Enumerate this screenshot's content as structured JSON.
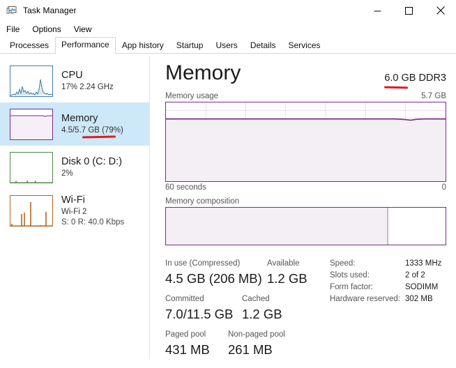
{
  "window": {
    "title": "Task Manager",
    "icon": "task-manager-icon",
    "controls": {
      "minimize": "–",
      "maximize": "☐",
      "close": "✕"
    }
  },
  "menu": {
    "items": [
      "File",
      "Options",
      "View"
    ]
  },
  "tabs": {
    "items": [
      "Processes",
      "Performance",
      "App history",
      "Startup",
      "Users",
      "Details",
      "Services"
    ],
    "active": "Performance"
  },
  "sidebar": {
    "items": [
      {
        "name": "CPU",
        "line1": "17%  2.24 GHz",
        "line2": "",
        "selected": false,
        "color": "#3d7fa6"
      },
      {
        "name": "Memory",
        "line1": "4.5/5.7 GB (79%)",
        "line2": "",
        "selected": true,
        "color": "#7a2b86"
      },
      {
        "name": "Disk 0 (C: D:)",
        "line1": "2%",
        "line2": "",
        "selected": false,
        "color": "#4a8c3f"
      },
      {
        "name": "Wi-Fi",
        "line1": "Wi-Fi 2",
        "line2": "S: 0 R: 40.0 Kbps",
        "selected": false,
        "color": "#b5651d"
      }
    ]
  },
  "main": {
    "title": "Memory",
    "spec": "6.0 GB DDR3",
    "usage_label": "Memory usage",
    "usage_max": "5.7 GB",
    "axis_left": "60 seconds",
    "axis_right": "0",
    "composition_label": "Memory composition"
  },
  "chart_data": {
    "type": "area",
    "title": "Memory usage",
    "ylabel": "",
    "xlabel": "60 seconds",
    "ylim": [
      0,
      5.7
    ],
    "ymax_label": "5.7 GB",
    "x_start_label": "60 seconds",
    "x_end_label": "0",
    "grid": true,
    "fill_percent": 79,
    "line_color": "#7a2b86",
    "fill_color": "#f4eef5",
    "values": [
      4.5,
      4.5,
      4.5,
      4.5,
      4.5,
      4.5,
      4.5,
      4.5,
      4.5,
      4.5,
      4.5,
      4.5,
      4.5,
      4.5,
      4.5,
      4.5,
      4.5,
      4.5,
      4.5,
      4.5,
      4.5,
      4.5,
      4.5,
      4.5,
      4.5,
      4.5,
      4.5,
      4.5,
      4.5,
      4.5,
      4.5,
      4.5,
      4.5,
      4.5,
      4.5,
      4.5,
      4.5,
      4.5,
      4.5,
      4.5,
      4.5,
      4.5,
      4.5,
      4.5,
      4.5,
      4.5,
      4.5,
      4.5,
      4.5,
      4.5,
      4.48,
      4.46,
      4.47,
      4.49,
      4.5,
      4.5,
      4.5,
      4.5,
      4.5,
      4.5
    ]
  },
  "composition": {
    "in_use_percent": 79,
    "divider_percent": 79
  },
  "stats": {
    "left": [
      {
        "caption": "In use (Compressed)",
        "value": "4.5 GB (206 MB)"
      },
      {
        "caption": "Available",
        "value": "1.2 GB"
      },
      {
        "caption": "Committed",
        "value": "7.0/11.5 GB"
      },
      {
        "caption": "Cached",
        "value": "1.2 GB"
      },
      {
        "caption": "Paged pool",
        "value": "431 MB"
      },
      {
        "caption": "Non-paged pool",
        "value": "261 MB"
      }
    ],
    "right": [
      {
        "key": "Speed:",
        "value": "1333 MHz"
      },
      {
        "key": "Slots used:",
        "value": "2 of 2"
      },
      {
        "key": "Form factor:",
        "value": "SODIMM"
      },
      {
        "key": "Hardware reserved:",
        "value": "302 MB"
      }
    ]
  },
  "annotations": {
    "color": "#e11b1b",
    "marks": [
      "underline-sidebar-79-percent",
      "underline-spec-6.0"
    ]
  }
}
